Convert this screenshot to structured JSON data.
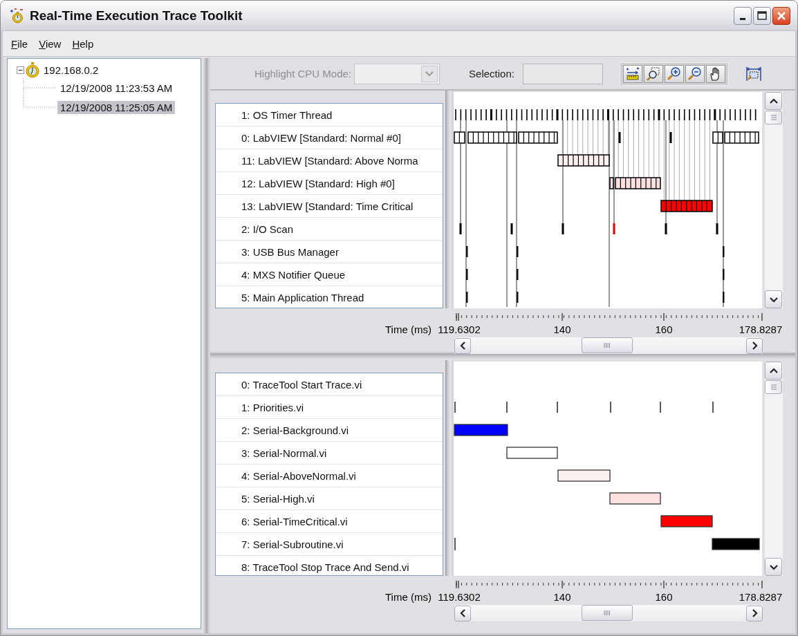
{
  "window": {
    "title": "Real-Time Execution Trace Toolkit"
  },
  "menu": [
    {
      "label": "File"
    },
    {
      "label": "View"
    },
    {
      "label": "Help"
    }
  ],
  "tree": [
    {
      "label": "192.168.0.2",
      "expanded": true,
      "selected": false,
      "children": [
        {
          "label": "12/19/2008 11:23:53 AM",
          "selected": false
        },
        {
          "label": "12/19/2008 11:25:05 AM",
          "selected": true
        }
      ]
    }
  ],
  "toolbar": {
    "highlight_cpu_mode": {
      "label": "Highlight CPU Mode:",
      "disabled": true
    },
    "selection": {
      "label": "Selection:"
    }
  },
  "thread_view": {
    "rows": [
      "1: OS Timer Thread",
      "0: LabVIEW [Standard: Normal #0]",
      "11: LabVIEW [Standard: Above Norma",
      "12: LabVIEW [Standard: High #0]",
      "13: LabVIEW [Standard: Time Critical",
      "2: I/O Scan",
      "3: USB Bus Manager",
      "4: MXS Notifier Queue",
      "5: Main Application Thread"
    ],
    "axis": {
      "label": "Time (ms)",
      "ticks": [
        "119.6302",
        "140",
        "160",
        "178.8287"
      ]
    }
  },
  "vi_view": {
    "rows": [
      "0: TraceTool Start Trace.vi",
      "1: Priorities.vi",
      "2: Serial-Background.vi",
      "3: Serial-Normal.vi",
      "4: Serial-AboveNormal.vi",
      "5: Serial-High.vi",
      "6: Serial-TimeCritical.vi",
      "7: Serial-Subroutine.vi",
      "8: TraceTool Stop Trace And Send.vi"
    ],
    "axis": {
      "label": "Time (ms)",
      "ticks": [
        "119.6302",
        "140",
        "160",
        "178.8287"
      ]
    }
  }
}
